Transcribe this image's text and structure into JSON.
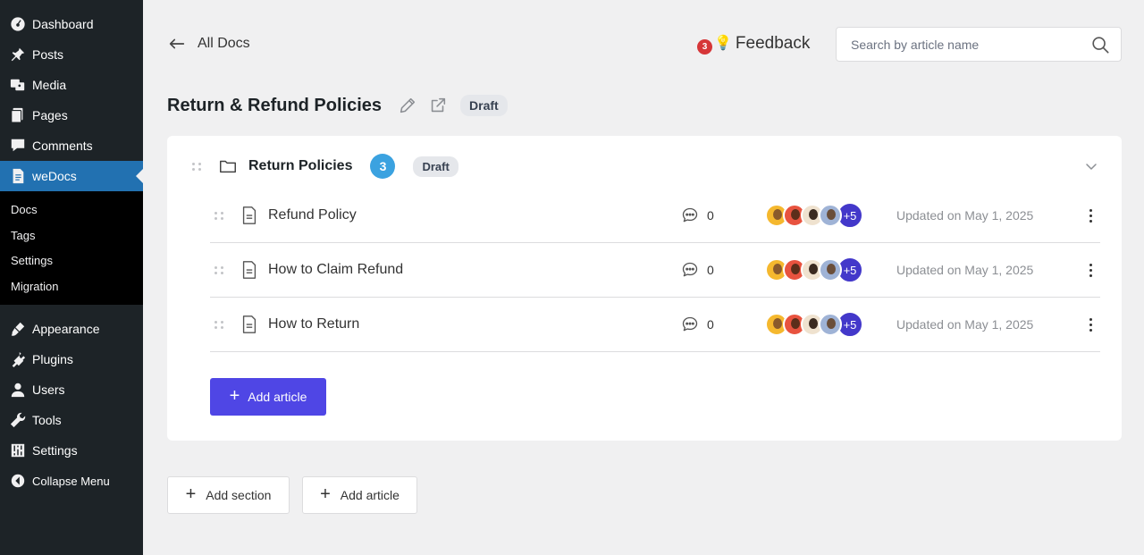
{
  "sidebar": {
    "items_top": [
      {
        "label": "Dashboard",
        "icon": "dashboard-icon"
      },
      {
        "label": "Posts",
        "icon": "pin-icon"
      },
      {
        "label": "Media",
        "icon": "media-icon"
      },
      {
        "label": "Pages",
        "icon": "pages-icon"
      },
      {
        "label": "Comments",
        "icon": "comment-icon"
      },
      {
        "label": "weDocs",
        "icon": "document-icon"
      }
    ],
    "submenu": [
      "Docs",
      "Tags",
      "Settings",
      "Migration"
    ],
    "items_bottom": [
      {
        "label": "Appearance",
        "icon": "brush-icon"
      },
      {
        "label": "Plugins",
        "icon": "plug-icon"
      },
      {
        "label": "Users",
        "icon": "user-icon"
      },
      {
        "label": "Tools",
        "icon": "wrench-icon"
      },
      {
        "label": "Settings",
        "icon": "sliders-icon"
      },
      {
        "label": "Collapse Menu",
        "icon": "collapse-icon"
      }
    ]
  },
  "header": {
    "back_label": "All Docs",
    "feedback_count": "3",
    "feedback_label": "Feedback",
    "search_placeholder": "Search by article name"
  },
  "doc": {
    "title": "Return & Refund Policies",
    "status": "Draft"
  },
  "section": {
    "title": "Return Policies",
    "count": "3",
    "status": "Draft",
    "articles": [
      {
        "title": "Refund Policy",
        "comments": "0",
        "more": "+5",
        "updated": "Updated on May 1, 2025"
      },
      {
        "title": "How to Claim Refund",
        "comments": "0",
        "more": "+5",
        "updated": "Updated on May 1, 2025"
      },
      {
        "title": "How to Return",
        "comments": "0",
        "more": "+5",
        "updated": "Updated on May 1, 2025"
      }
    ],
    "add_article_label": "Add article"
  },
  "footer_actions": {
    "add_section_label": "Add section",
    "add_article_label": "Add article"
  },
  "colors": {
    "sidebar_bg": "#1d2327",
    "active_menu": "#2271b1",
    "primary": "#4f46e5",
    "count_badge": "#3ba2e0",
    "feedback_badge": "#d63638"
  }
}
